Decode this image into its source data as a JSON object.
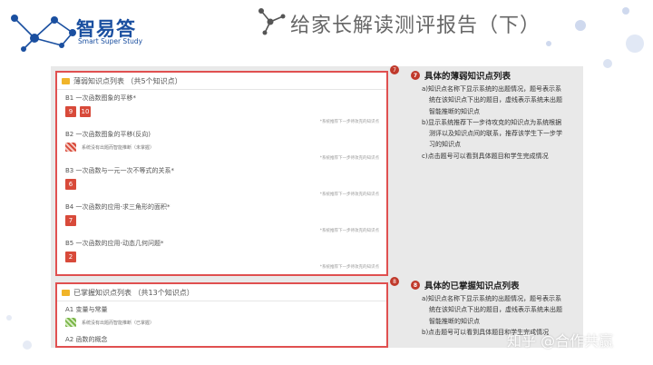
{
  "brand": {
    "name": "智易答",
    "tagline": "Smart Super Study",
    "color": "#1a4fa0"
  },
  "page": {
    "title": "给家长解读测评报告（下）"
  },
  "weak_section": {
    "marker": "7",
    "header": "薄弱知识点列表 （共5个知识点）",
    "items": [
      {
        "title": "B1 一次函数图象的平移*",
        "chips": [
          "9",
          "10"
        ],
        "note": "*系统推荐下一步待攻克的知识点"
      },
      {
        "title": "B2 一次函数图象的平移(反向)",
        "hatch_note": "系统没有出题而智能推断（未掌握）",
        "note": "*系统推荐下一步待攻克的知识点"
      },
      {
        "title": "B3 一次函数与一元一次不等式的关系*",
        "chips": [
          "6"
        ],
        "note": "*系统推荐下一步待攻克的知识点"
      },
      {
        "title": "B4 一次函数的应用-求三角形的面积*",
        "chips": [
          "7"
        ],
        "note": "*系统推荐下一步待攻克的知识点"
      },
      {
        "title": "B5 一次函数的应用-动态几何问题*",
        "chips": [
          "2"
        ],
        "note": "*系统推荐下一步待攻克的知识点"
      }
    ]
  },
  "mastered_section": {
    "marker": "8",
    "header": "已掌握知识点列表 （共13个知识点）",
    "items": [
      {
        "title": "A1 变量与常量",
        "hatch_note": "系统没有出题而智能推断（已掌握）"
      },
      {
        "title": "A2 函数的概念"
      }
    ]
  },
  "desc7": {
    "marker": "7",
    "title": "具体的薄弱知识点列表",
    "lines": [
      "a)知识点名称下显示系统的出题情况，题号表示系",
      "统在该知识点下出的题目，虚线表示系统未出题",
      "智能推断的知识点",
      "b)显示系统推荐下一步待攻克的知识点为系统根据",
      "测评以及知识点间的联系，推荐该学生下一步学",
      "习的知识点",
      "c)点击题号可以看到具体题目和学生完成情况"
    ]
  },
  "desc8": {
    "marker": "8",
    "title": "具体的已掌握知识点列表",
    "lines": [
      "a)知识点名称下显示系统的出题情况，题号表示系",
      "统在该知识点下出的题目，虚线表示系统未出题",
      "智能推断的知识点",
      "b)点击题号可以看到具体题目和学生完成情况"
    ]
  },
  "watermark": "知乎 @合作共赢"
}
